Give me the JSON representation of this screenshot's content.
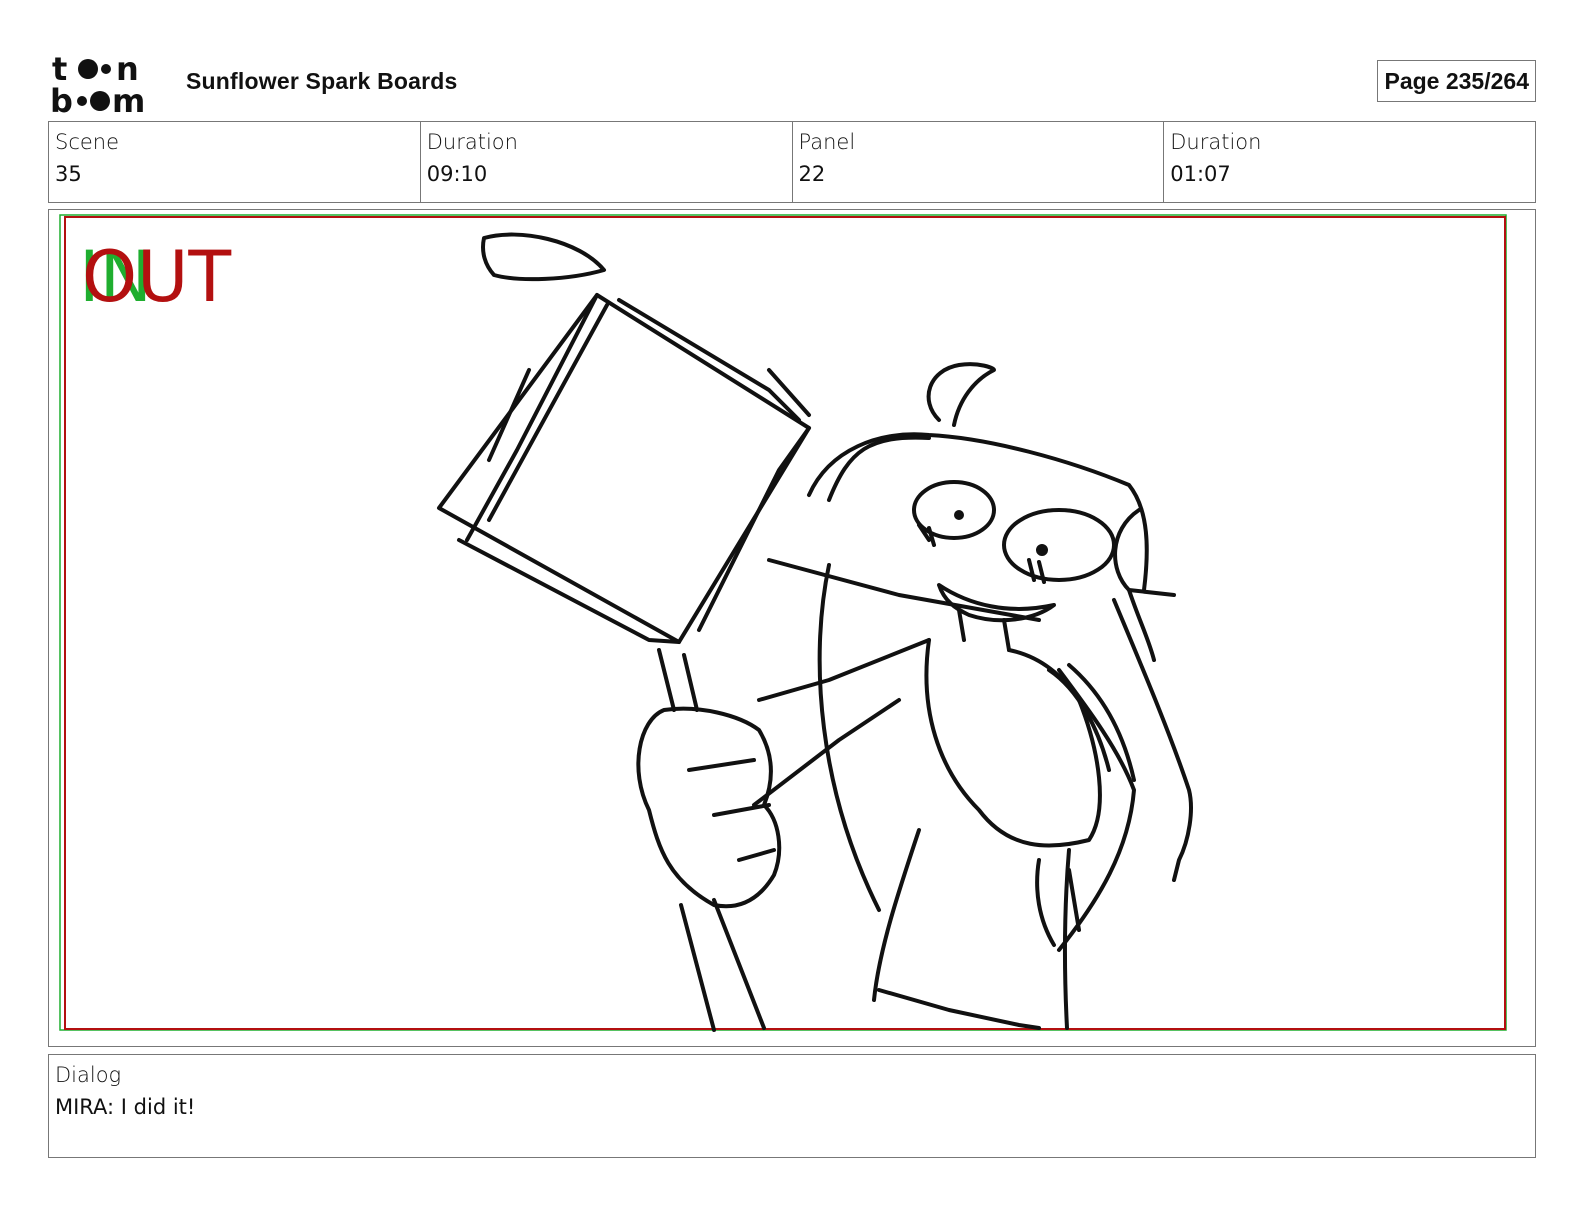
{
  "header": {
    "logo_text": "toon boom",
    "title": "Sunflower Spark Boards",
    "page_label": "Page 235/264"
  },
  "info": {
    "scene_label": "Scene",
    "scene_value": "35",
    "scene_duration_label": "Duration",
    "scene_duration_value": "09:10",
    "panel_label": "Panel",
    "panel_value": "22",
    "panel_duration_label": "Duration",
    "panel_duration_value": "01:07"
  },
  "panel": {
    "in_marker": "IN",
    "out_marker": "OUT",
    "in_color": "#1fae2f",
    "out_color": "#b31010"
  },
  "dialog": {
    "label": "Dialog",
    "text": "MIRA: I did it!"
  }
}
